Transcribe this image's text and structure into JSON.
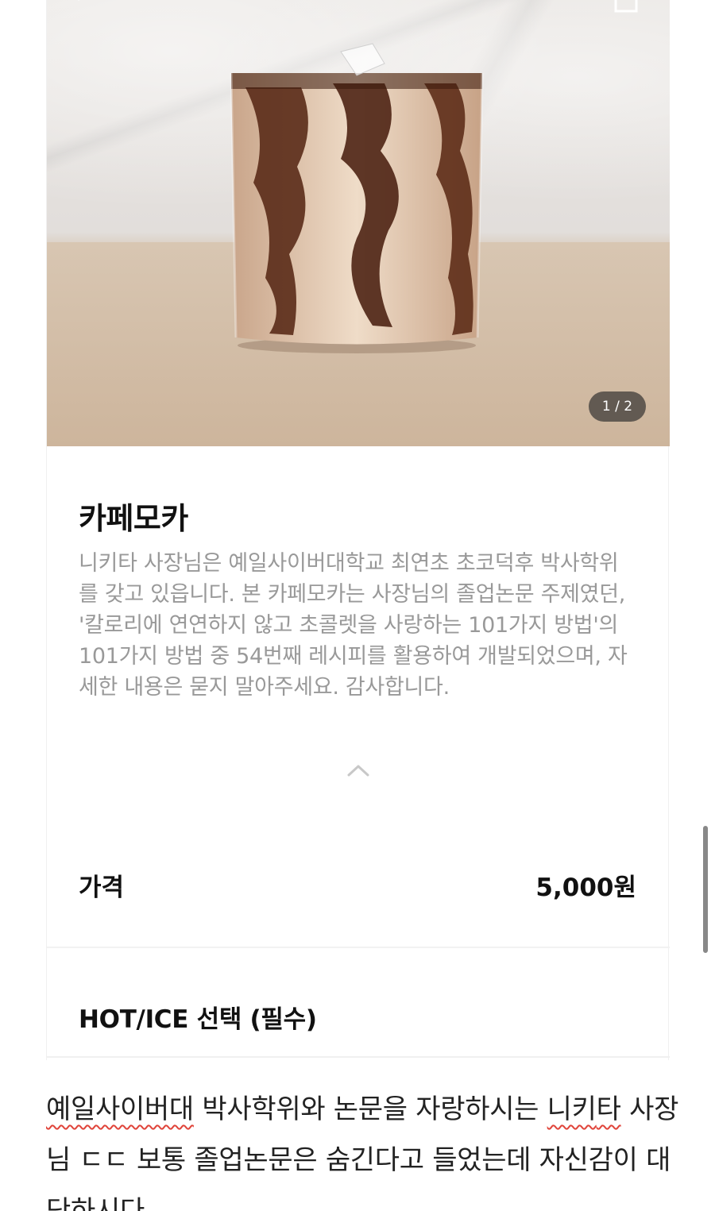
{
  "product": {
    "image_indicator": "1 / 2",
    "title": "카페모카",
    "description": "니키타 사장님은 예일사이버대학교 최연초 초코덕후 박사학위를 갖고 있읍니다. 본 카페모카는 사장님의 졸업논문 주제였던, '칼로리에 연연하지 않고 초콜렛을 사랑하는 101가지 방법'의 101가지 방법 중 54번째 레시피를 활용하여 개발되었으며, 자세한 내용은 묻지 말아주세요. 감사합니다.",
    "price_label": "가격",
    "price_value": "5,000원",
    "option_title": "HOT/ICE 선택 (필수)"
  },
  "caption": {
    "seg1": "예일사이버대",
    "seg2": " 박사학위와 논문을 자랑하시는 ",
    "seg3": "니키",
    "seg4": "타",
    "seg5": " 사장님 ㄷㄷ 보통 졸업논문은 숨긴다고 들었는데 자신감이 대단하시다"
  },
  "icons": {
    "back": "chevron-left-icon",
    "share": "share-icon",
    "collapse": "chevron-up-icon"
  },
  "colors": {
    "accent_squiggle": "#e0443a",
    "description_text": "#999999"
  }
}
